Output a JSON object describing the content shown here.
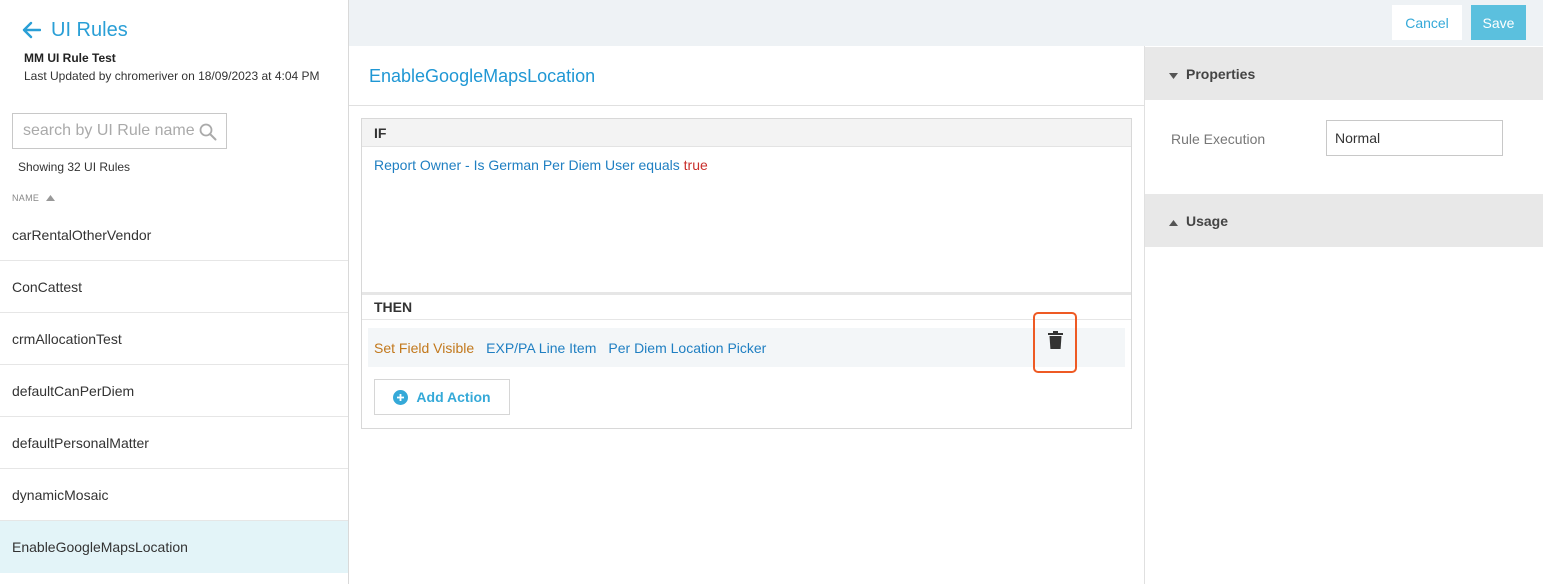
{
  "sidebar": {
    "back_title": "UI Rules",
    "rule_name": "MM UI Rule Test",
    "last_updated": "Last Updated by chromeriver on 18/09/2023 at 4:04 PM",
    "search": {
      "placeholder": "search by UI Rule name",
      "value": ""
    },
    "showing_count": "Showing 32 UI Rules",
    "column_header": "NAME",
    "items": [
      {
        "label": "carRentalOtherVendor"
      },
      {
        "label": "ConCattest"
      },
      {
        "label": "crmAllocationTest"
      },
      {
        "label": "defaultCanPerDiem"
      },
      {
        "label": "defaultPersonalMatter"
      },
      {
        "label": "dynamicMosaic"
      },
      {
        "label": "EnableGoogleMapsLocation",
        "active": true
      }
    ]
  },
  "toolbar": {
    "cancel_label": "Cancel",
    "save_label": "Save"
  },
  "main": {
    "title": "EnableGoogleMapsLocation",
    "if_label": "IF",
    "condition": {
      "text": "Report Owner - Is German Per Diem User equals",
      "value": "true"
    },
    "then_label": "THEN",
    "action": {
      "type": "Set Field Visible",
      "entity": "EXP/PA Line Item",
      "field": "Per Diem Location Picker"
    },
    "add_action_label": "Add Action"
  },
  "right_panel": {
    "properties_label": "Properties",
    "rule_execution_label": "Rule Execution",
    "rule_execution_value": "Normal",
    "usage_label": "Usage"
  },
  "colors": {
    "accent": "#2a9fd6",
    "save": "#5bc0de",
    "highlight": "#ee5a24",
    "active_row": "#e3f4f8"
  },
  "icons": [
    "arrow-left-icon",
    "search-icon",
    "sort-asc-icon",
    "trash-icon",
    "plus-circle-icon",
    "caret-down-icon",
    "caret-up-icon"
  ]
}
